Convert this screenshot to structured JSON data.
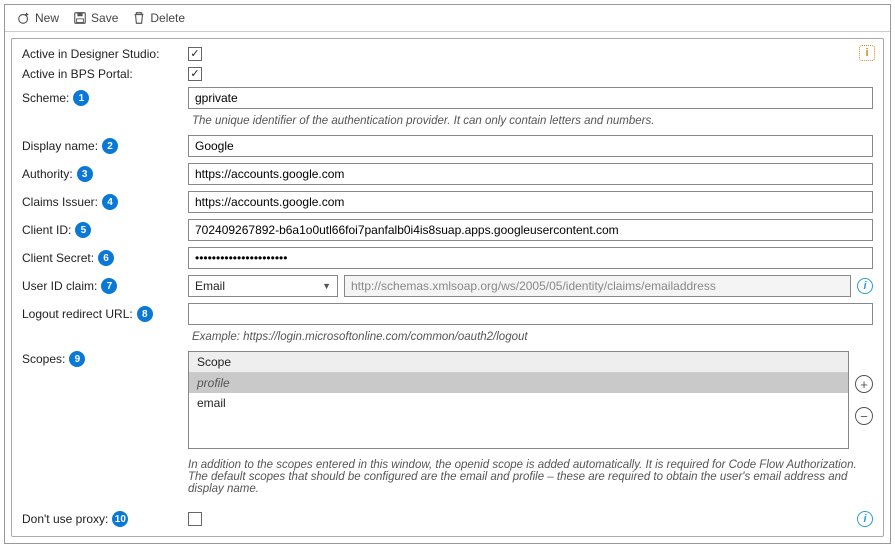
{
  "toolbar": {
    "new": "New",
    "save": "Save",
    "delete": "Delete"
  },
  "labels": {
    "activeDesigner": "Active in Designer Studio:",
    "activeBps": "Active in BPS Portal:",
    "scheme": "Scheme:",
    "displayName": "Display name:",
    "authority": "Authority:",
    "claimsIssuer": "Claims Issuer:",
    "clientId": "Client ID:",
    "clientSecret": "Client Secret:",
    "userIdClaim": "User ID claim:",
    "logoutRedirect": "Logout redirect URL:",
    "scopes": "Scopes:",
    "dontUseProxy": "Don't use proxy:"
  },
  "badges": {
    "scheme": "1",
    "displayName": "2",
    "authority": "3",
    "claimsIssuer": "4",
    "clientId": "5",
    "clientSecret": "6",
    "userIdClaim": "7",
    "logoutRedirect": "8",
    "scopes": "9",
    "dontUseProxy": "10"
  },
  "values": {
    "activeDesigner": true,
    "activeBps": true,
    "scheme": "gprivate",
    "displayName": "Google",
    "authority": "https://accounts.google.com",
    "claimsIssuer": "https://accounts.google.com",
    "clientId": "702409267892-b6a1o0utl66foi7panfalb0i4is8suap.apps.googleusercontent.com",
    "clientSecret": "••••••••••••••••••••••",
    "userIdClaimSelected": "Email",
    "userIdClaimResolved": "http://schemas.xmlsoap.org/ws/2005/05/identity/claims/emailaddress",
    "logoutRedirect": "",
    "dontUseProxy": false
  },
  "hints": {
    "scheme": "The unique identifier of the authentication provider. It can only contain letters and numbers.",
    "logoutRedirect": "Example: https://login.microsoftonline.com/common/oauth2/logout",
    "scopes": "In addition to the scopes entered in this window, the openid scope is added automatically. It is required for Code Flow Authorization. The default scopes that should be configured are the email and profile – these are required to obtain the user's email address and display name."
  },
  "scopes": {
    "header": "Scope",
    "items": [
      "profile",
      "email"
    ],
    "selectedIndex": 0
  }
}
